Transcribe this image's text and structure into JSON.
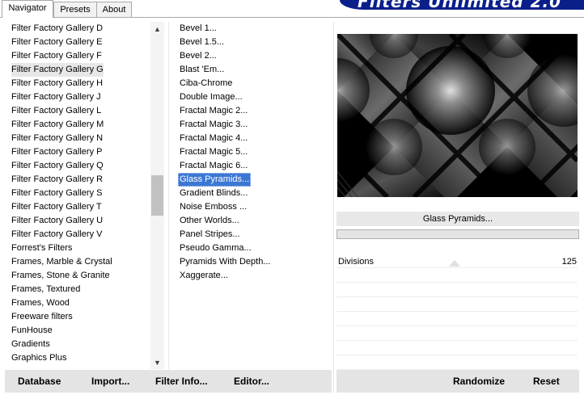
{
  "tabs": [
    "Navigator",
    "Presets",
    "About"
  ],
  "banner_title": "Filters Unlimited 2.0",
  "categories": [
    "Filter Factory Gallery D",
    "Filter Factory Gallery E",
    "Filter Factory Gallery F",
    "Filter Factory Gallery G",
    "Filter Factory Gallery H",
    "Filter Factory Gallery J",
    "Filter Factory Gallery L",
    "Filter Factory Gallery M",
    "Filter Factory Gallery N",
    "Filter Factory Gallery P",
    "Filter Factory Gallery Q",
    "Filter Factory Gallery R",
    "Filter Factory Gallery S",
    "Filter Factory Gallery T",
    "Filter Factory Gallery U",
    "Filter Factory Gallery V",
    "Forrest's Filters",
    "Frames, Marble & Crystal",
    "Frames, Stone & Granite",
    "Frames, Textured",
    "Frames, Wood",
    "Freeware filters",
    "FunHouse",
    "Gradients",
    "Graphics Plus"
  ],
  "selected_category": "Filter Factory Gallery G",
  "filters": [
    "Bevel 1...",
    "Bevel 1.5...",
    "Bevel 2...",
    "Blast 'Em...",
    "Ciba-Chrome",
    "Double Image...",
    "Fractal Magic 2...",
    "Fractal Magic 3...",
    "Fractal Magic 4...",
    "Fractal Magic 5...",
    "Fractal Magic 6...",
    "Glass Pyramids...",
    "Gradient Blinds...",
    "Noise Emboss ...",
    "Other Worlds...",
    "Panel Stripes...",
    "Pseudo Gamma...",
    "Pyramids With Depth...",
    "Xaggerate..."
  ],
  "selected_filter": "Glass Pyramids...",
  "current_filter_name": "Glass Pyramids...",
  "params": [
    {
      "label": "Divisions",
      "value": "125"
    }
  ],
  "buttons": {
    "database": "Database",
    "import": "Import...",
    "filter_info": "Filter Info...",
    "editor": "Editor...",
    "randomize": "Randomize",
    "reset": "Reset"
  },
  "colors": {
    "banner": "#0a1f8a",
    "selection": "#3c77d4"
  },
  "icons": [
    "scroll-up-arrow-icon",
    "scroll-down-arrow-icon"
  ]
}
